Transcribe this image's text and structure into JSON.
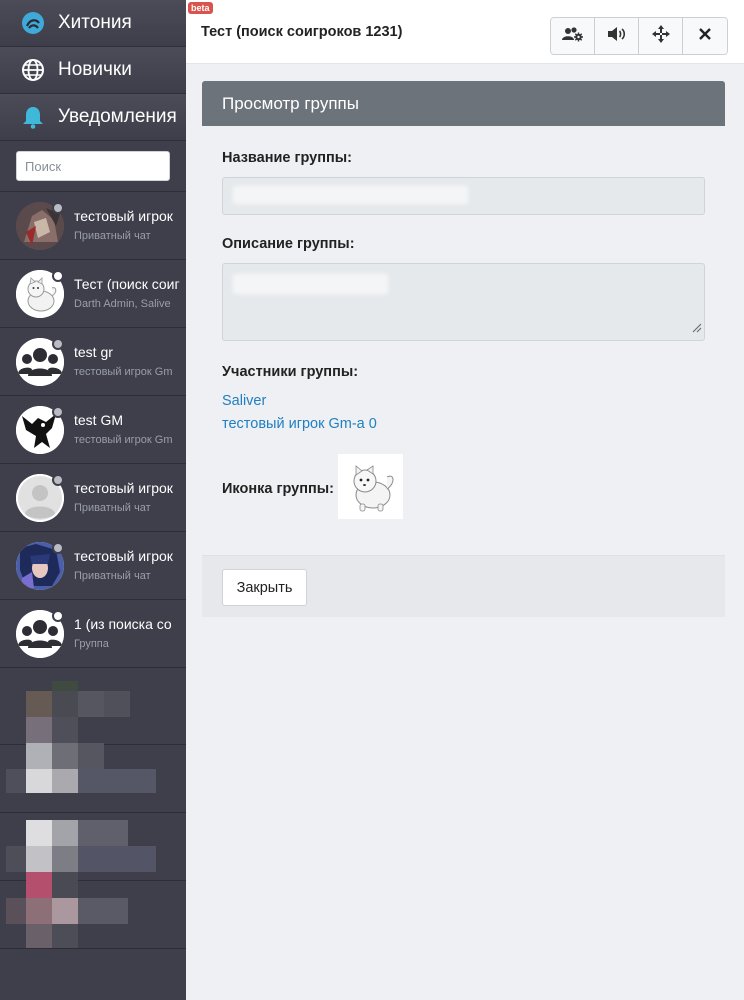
{
  "sidebar": {
    "nav": [
      {
        "label": "Хитония",
        "icon": "xitonia-logo-icon"
      },
      {
        "label": "Новички",
        "icon": "globe-icon"
      },
      {
        "label": "Уведомления",
        "icon": "bell-icon"
      }
    ],
    "search_placeholder": "Поиск",
    "chats": [
      {
        "name": "тестовый игрок",
        "sub": "Приватный чат",
        "avatar": "anime-character-avatar",
        "dot": "gray"
      },
      {
        "name": "Тест (поиск соиг",
        "sub": "Darth Admin, Salive",
        "avatar": "white-dog-avatar",
        "dot": "white"
      },
      {
        "name": "test gr",
        "sub": "тестовый игрок Gm",
        "avatar": "group-icon",
        "dot": "gray"
      },
      {
        "name": "test GM",
        "sub": "тестовый игрок Gm",
        "avatar": "black-dragon-avatar",
        "dot": "gray"
      },
      {
        "name": "тестовый игрок",
        "sub": "Приватный чат",
        "avatar": "default-user-avatar",
        "dot": "gray"
      },
      {
        "name": "тестовый игрок",
        "sub": "Приватный чат",
        "avatar": "anime-girl-avatar",
        "dot": "gray"
      },
      {
        "name": "1 (из поиска со",
        "sub": "Группа",
        "avatar": "group-icon",
        "dot": "white"
      }
    ]
  },
  "header": {
    "beta": "beta",
    "title": "Тест (поиск соигроков 1231)",
    "buttons": [
      "users-gear-icon",
      "volume-icon",
      "move-arrows-icon",
      "close-icon"
    ]
  },
  "modal": {
    "title": "Просмотр группы",
    "name_label": "Название группы:",
    "description_label": "Описание группы:",
    "members_label": "Участники группы:",
    "members": [
      "Saliver",
      "тестовый игрок Gm-а 0"
    ],
    "icon_label": "Иконка группы:",
    "close_label": "Закрыть"
  },
  "colors": {
    "sidebar_bg": "#3e3f4a",
    "panel_header_bg": "#6d737b",
    "link": "#1f7fc0",
    "beta_badge": "#d9534f"
  }
}
